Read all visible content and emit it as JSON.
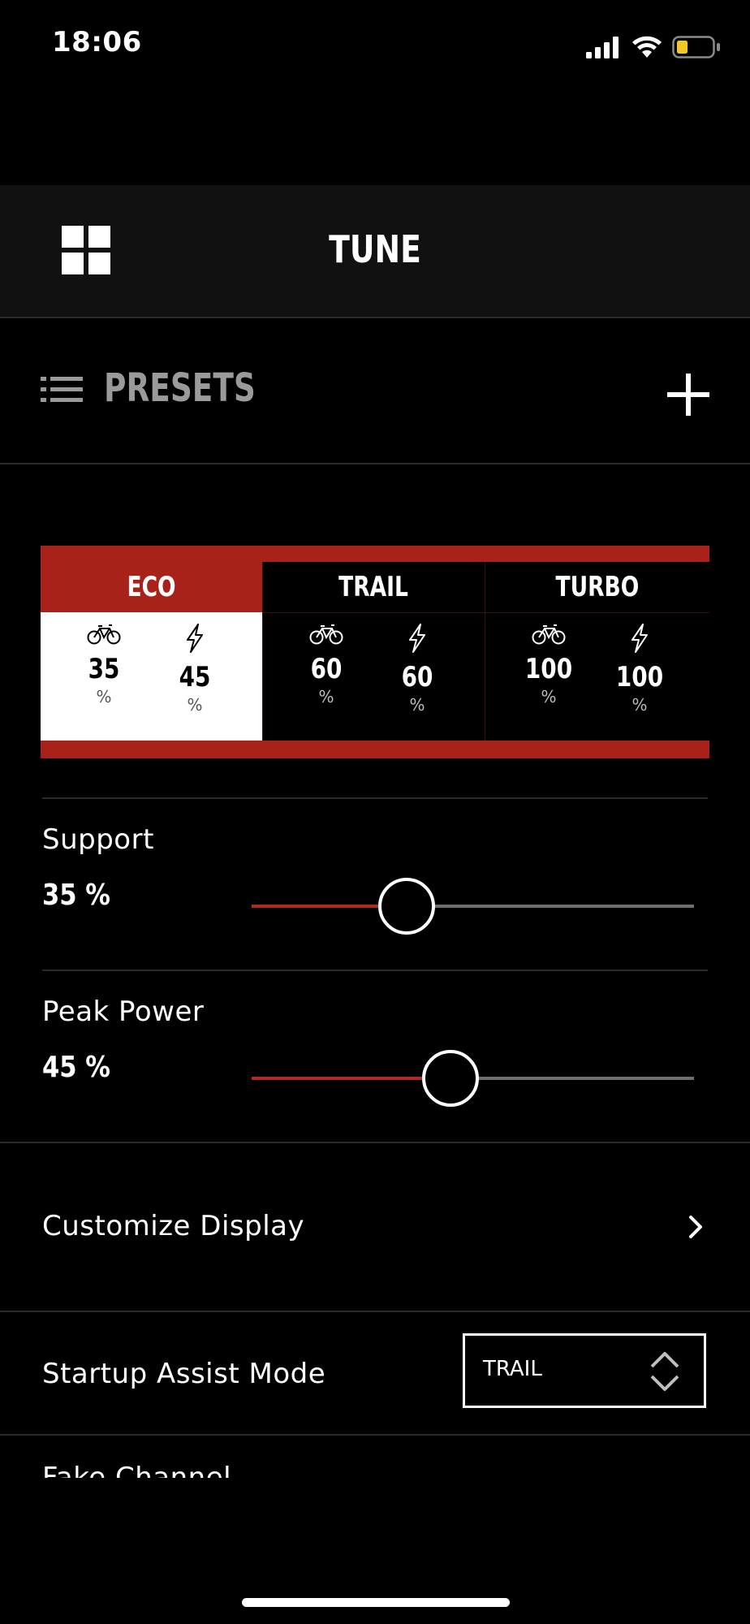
{
  "status_bar": {
    "time": "18:06"
  },
  "header": {
    "title": "TUNE"
  },
  "presets": {
    "label": "PRESETS"
  },
  "modes": [
    {
      "name": "ECO",
      "support": "35",
      "peak": "45",
      "unit": "%",
      "selected": true
    },
    {
      "name": "TRAIL",
      "support": "60",
      "peak": "60",
      "unit": "%",
      "selected": false
    },
    {
      "name": "TURBO",
      "support": "100",
      "peak": "100",
      "unit": "%",
      "selected": false
    }
  ],
  "sliders": {
    "support": {
      "label": "Support",
      "value_text": "35 %",
      "value": 35
    },
    "peak_power": {
      "label": "Peak Power",
      "value_text": "45 %",
      "value": 45
    }
  },
  "settings": {
    "customize_display": "Customize Display",
    "startup_assist_mode": {
      "label": "Startup Assist Mode",
      "selected": "TRAIL"
    },
    "fake_channel": "Fake Channel"
  },
  "colors": {
    "accent": "#a92219",
    "background": "#000000"
  }
}
